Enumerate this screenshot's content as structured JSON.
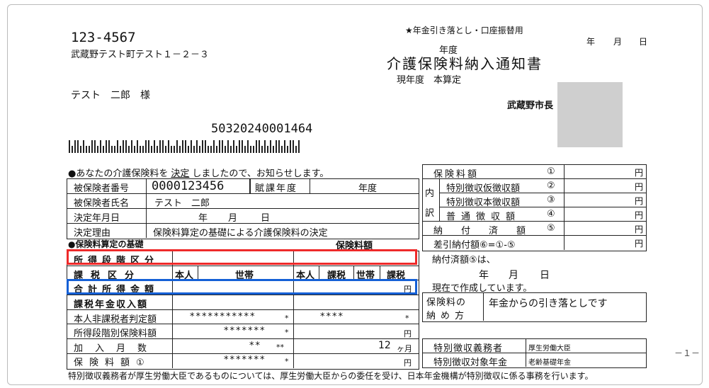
{
  "header": {
    "postal_code": "123-4567",
    "address": "武蔵野テスト町テスト１－２－３",
    "addressee": "テスト　二郎　様",
    "pension_notice": "★年金引き落とし・口座振替用",
    "date_labels": [
      "年",
      "月",
      "日"
    ],
    "fiscal_year_label": "年度",
    "title": "介護保険料納入通知書",
    "subtitle": "現年度　本算定",
    "issuer": "武蔵野市長",
    "document_number": "50320240001464"
  },
  "notice_line": {
    "prefix": "●あなたの介護保険料を",
    "decision": "決定",
    "suffix": "しましたので、お知らせします。"
  },
  "insured": {
    "number_label": "被保険者番号",
    "number_value": "0000123456",
    "tax_year_label": "賦課年度",
    "tax_year_value": "年度",
    "name_label": "被保険者氏名",
    "name_value": "テスト　二郎",
    "decision_date_label": "決定年月日",
    "decision_date_year": "年",
    "decision_date_month": "月",
    "decision_date_day": "日",
    "reason_label": "決定理由",
    "reason_value": "保険料算定の基礎による介護保険料の決定"
  },
  "basis": {
    "header": "●保険料算定の基礎",
    "premium_header": "保険料額",
    "income_stage_label": "所得段階区分",
    "tax_class_label": "課税区分",
    "tax_class_self": "本人",
    "tax_class_household": "世帯",
    "premium_cols": [
      "本人",
      "課税",
      "世帯",
      "課税"
    ],
    "total_income_label": "合計所得金額",
    "total_income_unit": "円",
    "pension_income_label": "課税年金収入額",
    "nontax_judge_label": "本人非課税者判定額",
    "nontax_judge_value": "***********",
    "nontax_judge_mark": "*",
    "nontax_right_value": "****",
    "nontax_right_mark": "*",
    "stage_premium_label": "所得段階別保険料額",
    "stage_premium_value": "*******",
    "stage_premium_mark": "*",
    "stage_premium_unit": "円",
    "enrolled_months_label": "加入月数",
    "enrolled_months_value": "**",
    "enrolled_months_mark": "**",
    "enrolled_months_right": "12",
    "enrolled_months_unit": "ヶ月",
    "premium_label": "保険料額①",
    "premium_value": "*******",
    "premium_mark": "*",
    "premium_unit": "円"
  },
  "summary": {
    "premium_label": "保険料額",
    "premium_num": "①",
    "unit": "円",
    "breakdown_label": [
      "内",
      "訳"
    ],
    "rows": [
      {
        "label": "特別徴収仮徴収額",
        "num": "②"
      },
      {
        "label": "特別徴収本徴収額",
        "num": "③"
      },
      {
        "label": "普通徴収額",
        "num": "④"
      }
    ],
    "paid_label": "納付済額",
    "paid_num": "⑤",
    "diff_label": "差引納付額⑥=①-⑤",
    "paid_note": "納付済額⑤は、",
    "paid_date": [
      "年",
      "月",
      "日"
    ],
    "paid_note2": "現在で作成しています。",
    "payment_method_label1": "保険料の",
    "payment_method_label2": "納め方",
    "payment_method_value": "年金からの引き落としです",
    "collector_label": "特別徴収義務者",
    "collector_value": "厚生労働大臣",
    "target_pension_label": "特別徴収対象年金",
    "target_pension_value": "老齢基礎年金"
  },
  "footer": {
    "note": "特別徴収義務者が厚生労働大臣であるものについては、厚生労働大臣からの委任を受け、日本年金機構が特別徴収に係る事務を行います。",
    "page": "－１－"
  }
}
